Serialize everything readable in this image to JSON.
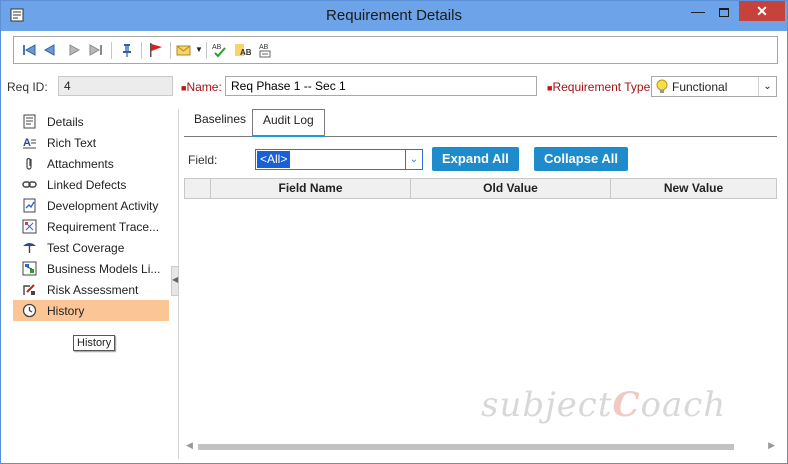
{
  "window": {
    "title": "Requirement Details"
  },
  "toolbar": {
    "buttons": [
      "first-record-icon",
      "previous-record-icon",
      "next-record-icon",
      "last-record-icon",
      "pin-icon",
      "flag-icon",
      "email-icon",
      "spelling-icon",
      "thesaurus-icon",
      "spelling-options-icon"
    ]
  },
  "fields": {
    "req_id_label": "Req ID:",
    "req_id_value": "4",
    "name_label": "Name:",
    "name_value": "Req Phase 1 -- Sec 1",
    "type_label": "Requirement Type:",
    "type_value": "Functional"
  },
  "sidebar": {
    "items": [
      {
        "label": "Details",
        "icon": "details-icon"
      },
      {
        "label": "Rich Text",
        "icon": "rich-text-icon"
      },
      {
        "label": "Attachments",
        "icon": "paperclip-icon"
      },
      {
        "label": "Linked Defects",
        "icon": "link-icon"
      },
      {
        "label": "Development Activity",
        "icon": "development-icon"
      },
      {
        "label": "Requirement Trace...",
        "icon": "trace-icon"
      },
      {
        "label": "Test Coverage",
        "icon": "coverage-icon"
      },
      {
        "label": "Business Models Li...",
        "icon": "business-model-icon"
      },
      {
        "label": "Risk Assessment",
        "icon": "risk-icon"
      },
      {
        "label": "History",
        "icon": "history-icon"
      }
    ],
    "active_index": 9,
    "tooltip": "History"
  },
  "tabs": [
    {
      "label": "Baselines",
      "active": false
    },
    {
      "label": "Audit Log",
      "active": true
    }
  ],
  "filter": {
    "field_label": "Field:",
    "field_value": "<All>",
    "expand_label": "Expand All",
    "collapse_label": "Collapse All"
  },
  "grid": {
    "columns": [
      "",
      "Field Name",
      "Old Value",
      "New Value"
    ],
    "rows": []
  },
  "watermark": {
    "text_a": "subject",
    "text_b": "C",
    "text_c": "oach"
  },
  "colors": {
    "accent": "#1e8ccc",
    "titlebar": "#6da3e8",
    "active_item": "#fbc595",
    "required": "#c2141a"
  }
}
